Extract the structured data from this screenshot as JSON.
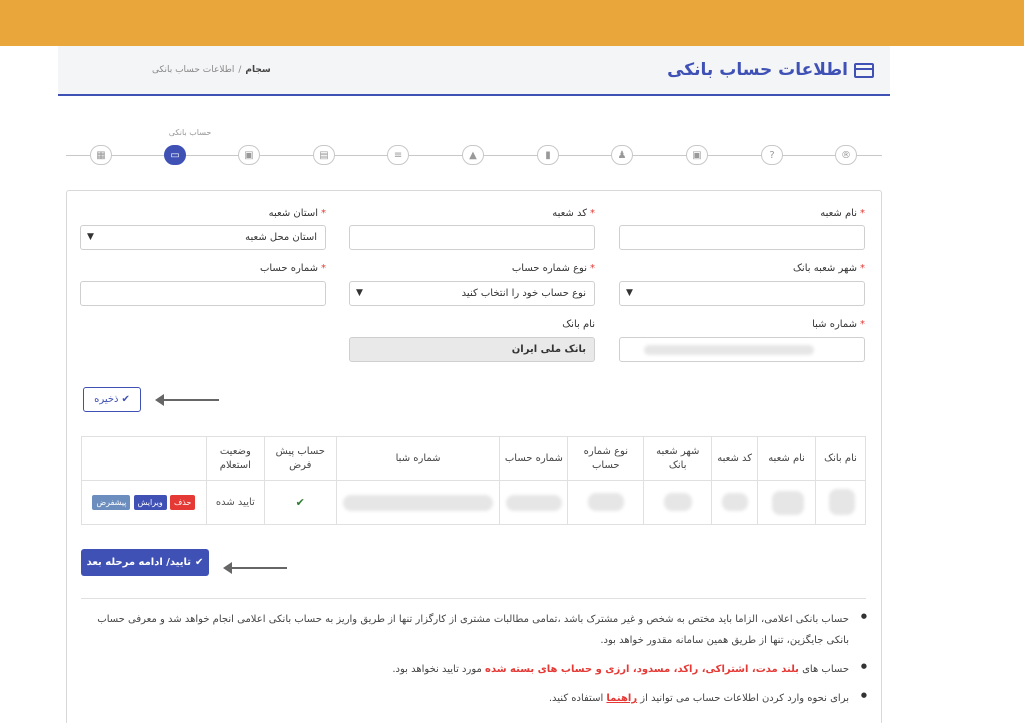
{
  "header": {
    "title": "اطلاعات حساب بانکی",
    "breadcrumb": [
      "سجام",
      "اطلاعات حساب بانکی"
    ],
    "breadcrumb_sep": "/"
  },
  "stepper": {
    "active_label": "حساب بانکی",
    "steps": [
      {
        "icon": "registered-icon",
        "glyph": "®"
      },
      {
        "icon": "question-icon",
        "glyph": "?"
      },
      {
        "icon": "money-icon",
        "glyph": "▣"
      },
      {
        "icon": "person-icon",
        "glyph": "♟"
      },
      {
        "icon": "bookmark-icon",
        "glyph": "▮"
      },
      {
        "icon": "graduation-icon",
        "glyph": "▲"
      },
      {
        "icon": "list-icon",
        "glyph": "≡"
      },
      {
        "icon": "briefcase-icon",
        "glyph": "▤"
      },
      {
        "icon": "money-icon",
        "glyph": "▣"
      },
      {
        "icon": "card-icon",
        "glyph": "▭"
      },
      {
        "icon": "id-card-icon",
        "glyph": "▦"
      }
    ]
  },
  "form": {
    "branch_name_label": "نام شعبه",
    "branch_code_label": "کد شعبه",
    "branch_province_label": "استان شعبه",
    "branch_province_value": "استان محل شعبه",
    "bank_city_label": "شهر شعبه بانک",
    "account_type_label": "نوع شماره حساب",
    "account_type_value": "نوع حساب خود را انتخاب کنید",
    "account_number_label": "شماره حساب",
    "sheba_label": "شماره شبا",
    "bank_name_label": "نام بانک",
    "bank_name_value": "بانک ملی ایران",
    "required_mark": "*"
  },
  "buttons": {
    "save": "ذخیره",
    "confirm": "تایید/ ادامه مرحله بعد",
    "check_glyph": "✔"
  },
  "table": {
    "headers": [
      "نام بانک",
      "نام شعبه",
      "کد شعبه",
      "شهر شعبه بانک",
      "نوع شماره حساب",
      "شماره حساب",
      "شماره شبا",
      "حساب پیش فرض",
      "وضعیت استعلام",
      ""
    ],
    "row": {
      "status": "تایید شده",
      "default_check": "✔",
      "actions": [
        "حذف",
        "ویرایش",
        "پیشفرض"
      ]
    }
  },
  "notes": {
    "n1": "حساب بانکی اعلامی، الزاما باید مختص به شخص و غیر مشترک باشد ،تمامی مطالبات مشتری از کارگزار تنها از طریق واریز به حساب بانکی اعلامی انجام خواهد شد و معرفی حساب بانکی جایگزین، تنها از طریق همین سامانه مقدور خواهد بود.",
    "n2_pre": "حساب های",
    "n2_hl": "بلند مدت، اشتراکی، راکد، مسدود، ارزی و حساب های بسته شده",
    "n2_post": "مورد تایید نخواهد بود.",
    "n3_pre": "برای نحوه وارد کردن اطلاعات حساب می توانید از",
    "n3_link": "راهنما",
    "n3_post": "استفاده کنید."
  },
  "colors": {
    "topbar": "#e9a73b",
    "accent": "#3f51b5",
    "danger": "#e53935"
  }
}
